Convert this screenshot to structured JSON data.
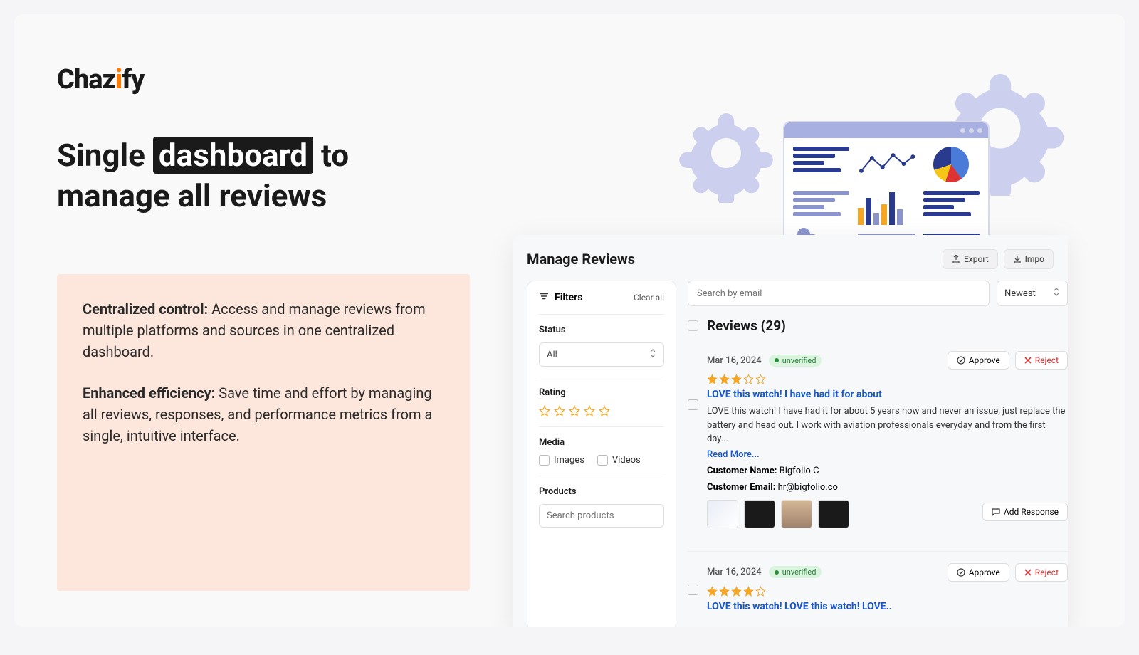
{
  "brand": {
    "name_pre": "Chaz",
    "name_accent": "i",
    "name_mid": "f",
    "name_post": "y"
  },
  "headline": {
    "pre": "Single ",
    "highlight": "dashboard",
    "post": " to manage all reviews"
  },
  "desc": {
    "p1_strong": "Centralized control:",
    "p1": " Access and manage reviews from multiple platforms and sources in one centralized dashboard.",
    "p2_strong": "Enhanced efficiency:",
    "p2": " Save time and effort by managing all reviews, responses, and performance metrics from a single, intuitive interface."
  },
  "app": {
    "title": "Manage Reviews",
    "export": "Export",
    "import": "Impo",
    "search_placeholder": "Search by email",
    "sort": "Newest",
    "reviews_label": "Reviews (29)"
  },
  "filters": {
    "title": "Filters",
    "clear": "Clear all",
    "status_label": "Status",
    "status_value": "All",
    "rating_label": "Rating",
    "media_label": "Media",
    "media_images": "Images",
    "media_videos": "Videos",
    "products_label": "Products",
    "products_placeholder": "Search products"
  },
  "review1": {
    "date": "Mar 16, 2024",
    "badge": "unverified",
    "approve": "Approve",
    "reject": "Reject",
    "rating": 3,
    "title": "LOVE this watch! I have had it for about",
    "text": "LOVE this watch! I have had it for about 5 years now and never an issue, just replace the battery and head out. I work with aviation professionals everyday and from the first day...",
    "readmore": "Read More...",
    "name_label": "Customer Name:",
    "name": " Bigfolio C",
    "email_label": "Customer Email:",
    "email": " hr@bigfolio.co",
    "add_response": "Add Response"
  },
  "review2": {
    "date": "Mar 16, 2024",
    "badge": "unverified",
    "approve": "Approve",
    "reject": "Reject",
    "rating": 4,
    "title": "LOVE this watch! LOVE this watch! LOVE.."
  },
  "colors": {
    "orange": "#ff7a00",
    "star": "#f5a623",
    "link": "#1858c9"
  }
}
